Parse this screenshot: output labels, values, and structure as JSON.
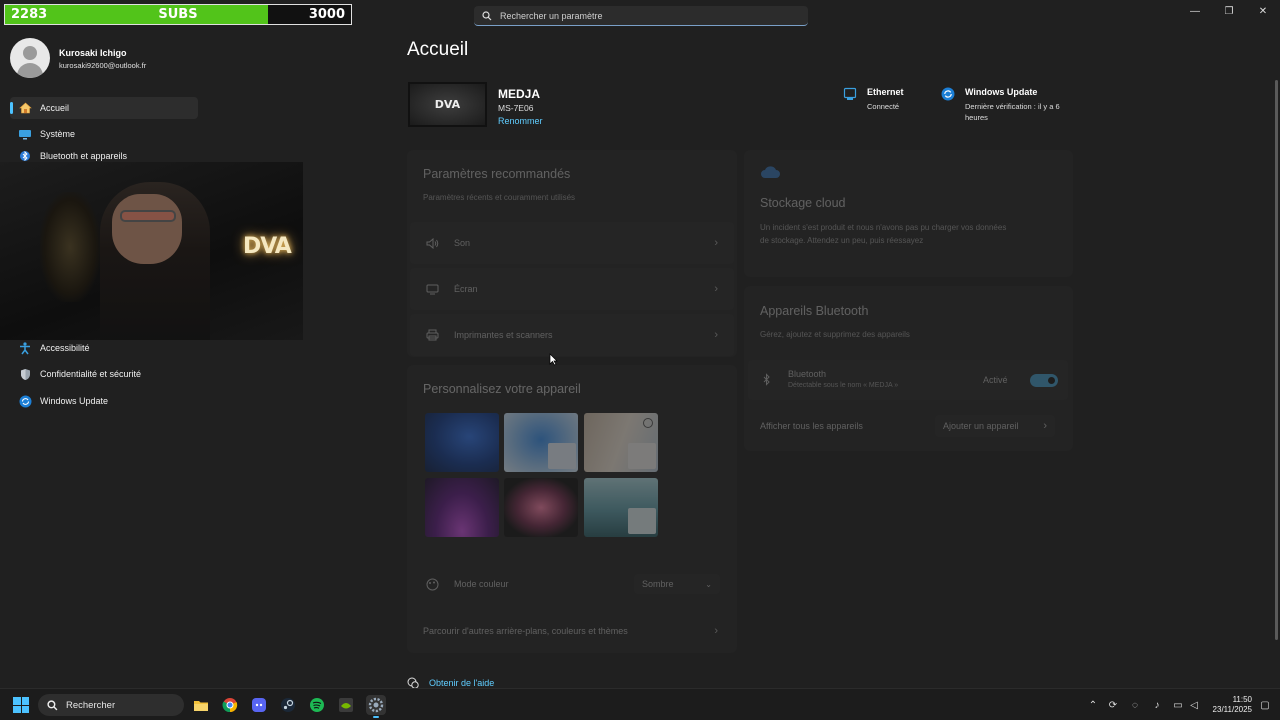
{
  "subs": {
    "current": "2283",
    "label": "SUBS",
    "goal": "3000",
    "progress_fraction": 0.761
  },
  "search": {
    "placeholder": "Rechercher un paramètre"
  },
  "user": {
    "name": "Kurosaki Ichigo",
    "email": "kurosaki92600@outlook.fr"
  },
  "sidebar": {
    "items": [
      {
        "label": "Accueil",
        "icon": "home-icon",
        "active": true
      },
      {
        "label": "Système",
        "icon": "display-icon"
      },
      {
        "label": "Bluetooth et appareils",
        "icon": "bluetooth-icon"
      },
      {
        "label": "Accessibilité",
        "icon": "accessibility-icon"
      },
      {
        "label": "Confidentialité et sécurité",
        "icon": "shield-icon"
      },
      {
        "label": "Windows Update",
        "icon": "update-icon"
      }
    ]
  },
  "main": {
    "title": "Accueil",
    "device": {
      "logo_text": "DVA",
      "name": "MEDJA",
      "model": "MS-7E06",
      "rename_label": "Renommer"
    },
    "ethernet": {
      "title": "Ethernet",
      "status": "Connecté"
    },
    "windows_update": {
      "title": "Windows Update",
      "status_line1": "Dernière vérification : il y a 6",
      "status_line2": "heures"
    },
    "recommended": {
      "title": "Paramètres recommandés",
      "subtitle": "Paramètres récents et couramment utilisés",
      "rows": [
        {
          "label": "Son",
          "icon": "speaker-icon"
        },
        {
          "label": "Écran",
          "icon": "monitor-icon"
        },
        {
          "label": "Imprimantes et scanners",
          "icon": "printer-icon"
        }
      ]
    },
    "personalize": {
      "title": "Personnalisez votre appareil",
      "color_mode_label": "Mode couleur",
      "color_mode_value": "Sombre",
      "browse_label": "Parcourir d'autres arrière-plans, couleurs et thèmes"
    },
    "cloud": {
      "title": "Stockage cloud",
      "line1": "Un incident s'est produit et nous n'avons pas pu charger vos données",
      "line2": "de stockage. Attendez un peu, puis réessayez"
    },
    "bluetooth": {
      "title": "Appareils Bluetooth",
      "subtitle": "Gérez, ajoutez et supprimez des appareils",
      "row_title": "Bluetooth",
      "row_sub": "Détectable sous le nom « MEDJA »",
      "state": "Activé",
      "view_all": "Afficher tous les appareils",
      "add_device": "Ajouter un appareil"
    },
    "help_label": "Obtenir de l'aide"
  },
  "webcam": {
    "neon_text": "DVA"
  },
  "taskbar": {
    "search_label": "Rechercher",
    "apps": [
      "file-explorer-icon",
      "chrome-icon",
      "discord-icon",
      "steam-icon",
      "spotify-icon",
      "nvidia-icon",
      "settings-icon"
    ],
    "time": "11:50",
    "date": "23/11/2025"
  },
  "colors": {
    "accent": "#4cc2ff",
    "link": "#60cdff",
    "subs_fill": "#52c41a",
    "background": "#202020"
  }
}
